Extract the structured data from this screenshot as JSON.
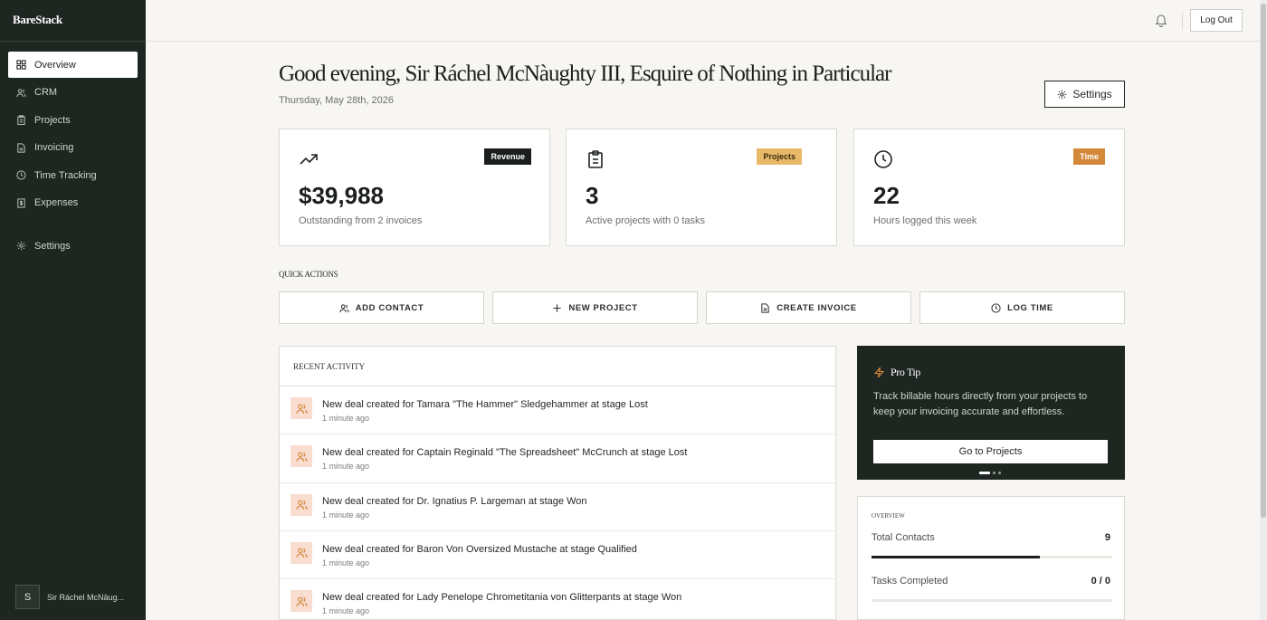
{
  "brand": "BareStack",
  "sidebar": {
    "items": [
      {
        "label": "Overview",
        "icon": "grid-icon",
        "active": true
      },
      {
        "label": "CRM",
        "icon": "users-icon"
      },
      {
        "label": "Projects",
        "icon": "clipboard-icon"
      },
      {
        "label": "Invoicing",
        "icon": "file-icon"
      },
      {
        "label": "Time Tracking",
        "icon": "clock-icon"
      },
      {
        "label": "Expenses",
        "icon": "dollar-icon"
      }
    ],
    "settings_label": "Settings",
    "user": {
      "initial": "S",
      "name": "Sir Ráchel McNäug..."
    }
  },
  "topbar": {
    "logout_label": "Log Out"
  },
  "header": {
    "greeting": "Good evening, Sir Ráchel McNàughty III, Esquire of Nothing in Particular",
    "date": "Thursday, May 28th, 2026",
    "settings_label": "Settings"
  },
  "stats": [
    {
      "badge": "Revenue",
      "value": "$39,988",
      "sub": "Outstanding from 2 invoices",
      "icon": "trending-up-icon",
      "badge_bg": "#1b1f1c",
      "badge_fg": "#ffffff"
    },
    {
      "badge": "Projects",
      "value": "3",
      "sub": "Active projects with 0 tasks",
      "icon": "clipboard-icon",
      "badge_bg": "#e7b969",
      "badge_fg": "#3a2a0e"
    },
    {
      "badge": "Time",
      "value": "22",
      "sub": "Hours logged this week",
      "icon": "clock-icon",
      "badge_bg": "#d4883a",
      "badge_fg": "#ffffff"
    }
  ],
  "quick_actions": {
    "label": "QUICK ACTIONS",
    "items": [
      {
        "label": "ADD CONTACT",
        "icon": "users-icon"
      },
      {
        "label": "NEW PROJECT",
        "icon": "plus-icon"
      },
      {
        "label": "CREATE INVOICE",
        "icon": "file-icon"
      },
      {
        "label": "LOG TIME",
        "icon": "clock-icon"
      }
    ]
  },
  "activity": {
    "label": "RECENT ACTIVITY",
    "items": [
      {
        "text": "New deal created for Tamara \"The Hammer\" Sledgehammer at stage Lost",
        "time": "1 minute ago"
      },
      {
        "text": "New deal created for Captain Reginald \"The Spreadsheet\" McCrunch at stage Lost",
        "time": "1 minute ago"
      },
      {
        "text": "New deal created for Dr. Ignatius P. Largeman at stage Won",
        "time": "1 minute ago"
      },
      {
        "text": "New deal created for Baron Von Oversized Mustache at stage Qualified",
        "time": "1 minute ago"
      },
      {
        "text": "New deal created for Lady Penelope Chrometitania von Glitterpants at stage Won",
        "time": "1 minute ago"
      }
    ]
  },
  "protip": {
    "title": "Pro Tip",
    "text": "Track billable hours directly from your projects to keep your invoicing accurate and effortless.",
    "button": "Go to Projects"
  },
  "overview": {
    "label": "OVERVIEW",
    "rows": [
      {
        "label": "Total Contacts",
        "value": "9",
        "fill": 0.7
      },
      {
        "label": "Tasks Completed",
        "value": "0 / 0",
        "fill": 0
      }
    ]
  },
  "colors": {
    "sidebar_bg": "#1e2621",
    "accent_orange": "#d4883a",
    "activity_icon_bg": "#f8ddd0"
  }
}
